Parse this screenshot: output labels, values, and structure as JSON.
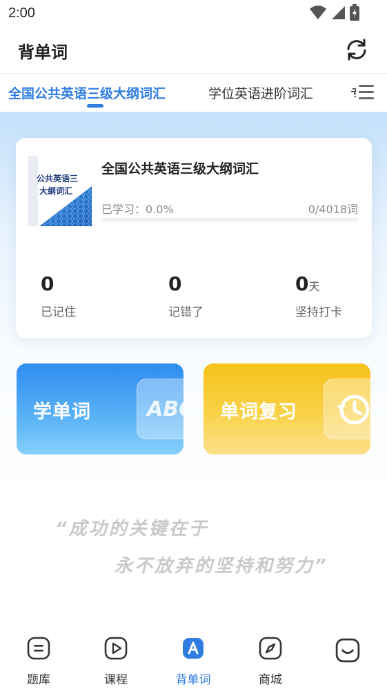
{
  "status_bar": {
    "time": "2:00"
  },
  "header": {
    "title": "背单词"
  },
  "tabs": [
    {
      "label": "全国公共英语三级大纲词汇",
      "active": true
    },
    {
      "label": "学位英语进阶词汇",
      "active": false
    },
    {
      "label": "专",
      "active": false
    }
  ],
  "book": {
    "cover_text_line1": "公共英语三",
    "cover_text_line2": "大纲词汇",
    "title": "全国公共英语三级大纲词汇",
    "progress_label": "已学习：0.0%",
    "progress_count": "0/4018词",
    "progress_fraction": 0.0
  },
  "stats": [
    {
      "value": "0",
      "unit": "",
      "label": "已记住"
    },
    {
      "value": "0",
      "unit": "",
      "label": "记错了"
    },
    {
      "value": "0",
      "unit": "天",
      "label": "坚持打卡"
    }
  ],
  "actions": {
    "learn_label": "学单词",
    "learn_badge": "ABC",
    "review_label": "单词复习"
  },
  "quote": {
    "line1": "“成功的关键在于",
    "line2": "永不放弃的坚持和努力”"
  },
  "bottom_nav": [
    {
      "label": "题库",
      "icon": "question-bank-icon",
      "active": false
    },
    {
      "label": "课程",
      "icon": "play-course-icon",
      "active": false
    },
    {
      "label": "背单词",
      "icon": "vocabulary-icon",
      "active": true
    },
    {
      "label": "商城",
      "icon": "compass-shop-icon",
      "active": false
    },
    {
      "label": "",
      "icon": "profile-icon",
      "active": false
    }
  ],
  "colors": {
    "accent": "#2f7de1",
    "learn_card": "#2f8cf0",
    "review_card": "#f6c21a"
  }
}
